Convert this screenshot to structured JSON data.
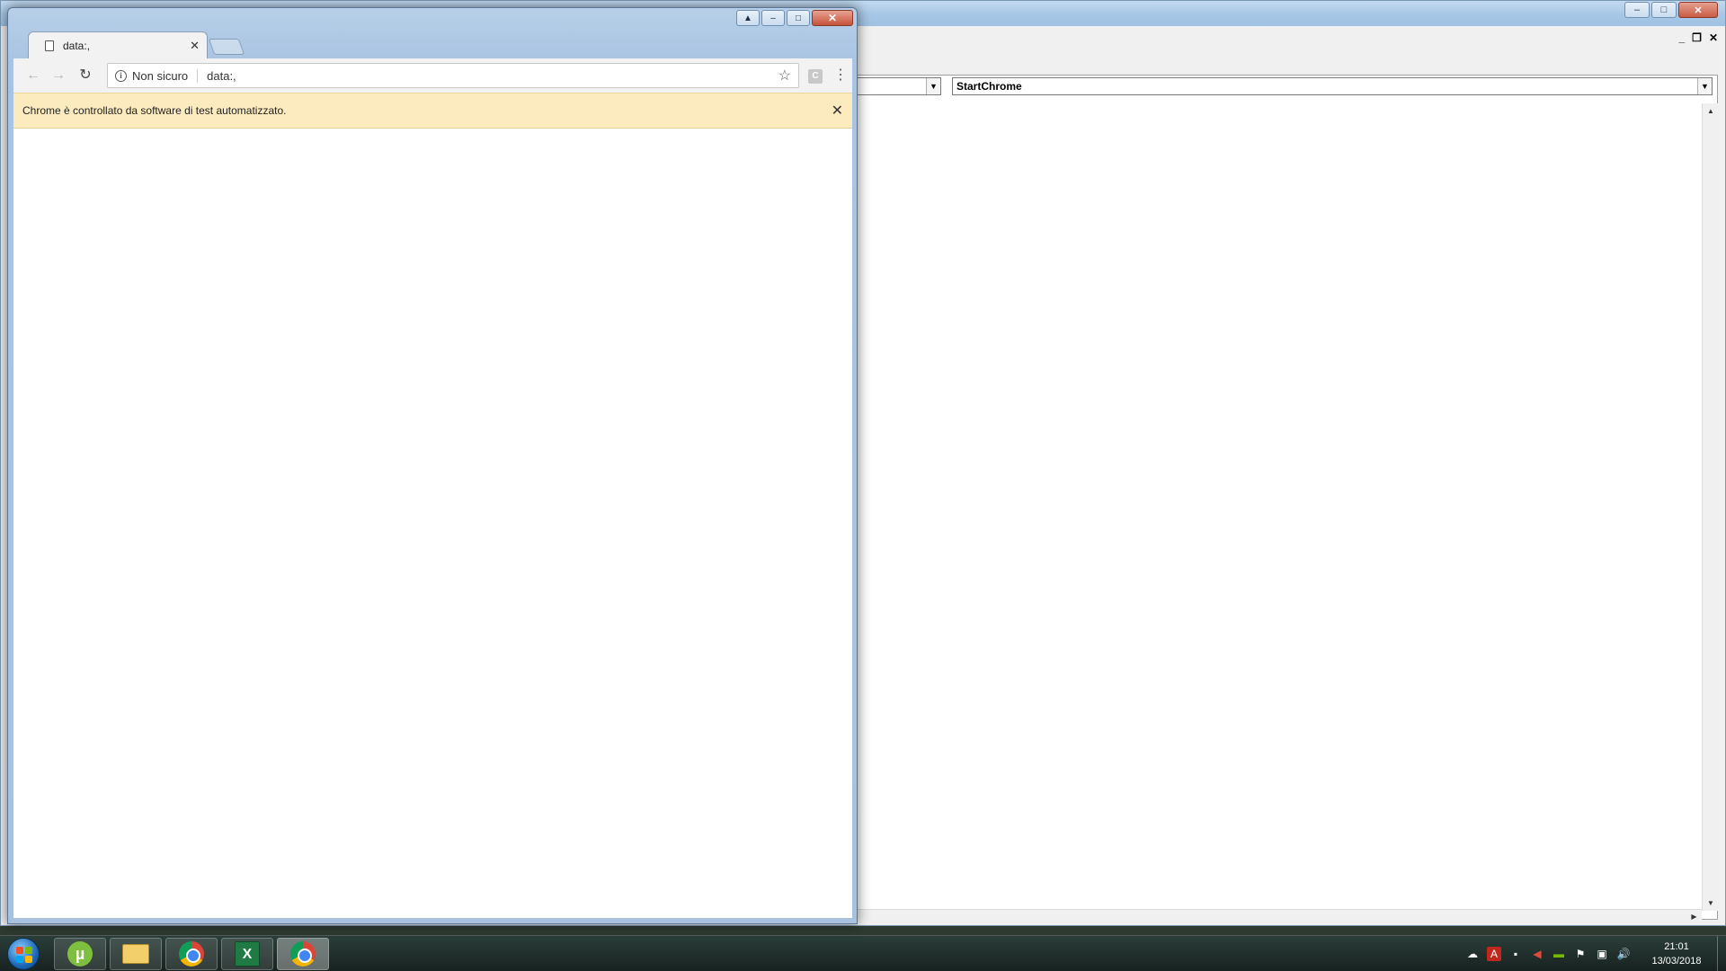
{
  "vba_editor": {
    "procedure_combo": "StartChrome",
    "object_combo": "",
    "title_controls": [
      "–",
      "□",
      "✕"
    ],
    "mdi_controls": [
      "_",
      "❐",
      "✕"
    ]
  },
  "chrome": {
    "tab": {
      "title": "data:,",
      "close": "✕"
    },
    "title_controls": [
      "▲",
      "–",
      "□",
      "✕"
    ],
    "toolbar": {
      "back": "←",
      "forward": "→",
      "reload": "↻",
      "security_label": "Non sicuro",
      "info_glyph": "i",
      "url": "data:,",
      "star": "☆",
      "extension": "C",
      "menu": "⋮"
    },
    "infobar": {
      "text": "Chrome è controllato da software di test automatizzato.",
      "close": "✕"
    }
  },
  "taskbar": {
    "apps": [
      {
        "name": "uTorrent",
        "icon": "utorrent-icon",
        "glyph": "µ"
      },
      {
        "name": "Esplora risorse",
        "icon": "folder-icon"
      },
      {
        "name": "Google Chrome",
        "icon": "chrome-icon"
      },
      {
        "name": "Microsoft Excel",
        "icon": "excel-icon",
        "glyph": "X"
      },
      {
        "name": "Google Chrome",
        "icon": "chrome-icon",
        "active": true
      }
    ],
    "tray_icons": [
      "cloud-icon",
      "acrobat-icon",
      "network-activity-icon",
      "antivirus-icon",
      "nvidia-icon",
      "flag-icon",
      "network-icon",
      "volume-icon"
    ],
    "tray_glyphs": [
      "☁",
      "A",
      "▪",
      "◀",
      "▬",
      "⚑",
      "▣",
      "🔊"
    ],
    "clock": {
      "time": "21:01",
      "date": "13/03/2018"
    }
  },
  "colors": {
    "infobar_bg": "#fcebbf",
    "aero_title": "#a9c4e2",
    "close_red": "#c7523b"
  }
}
